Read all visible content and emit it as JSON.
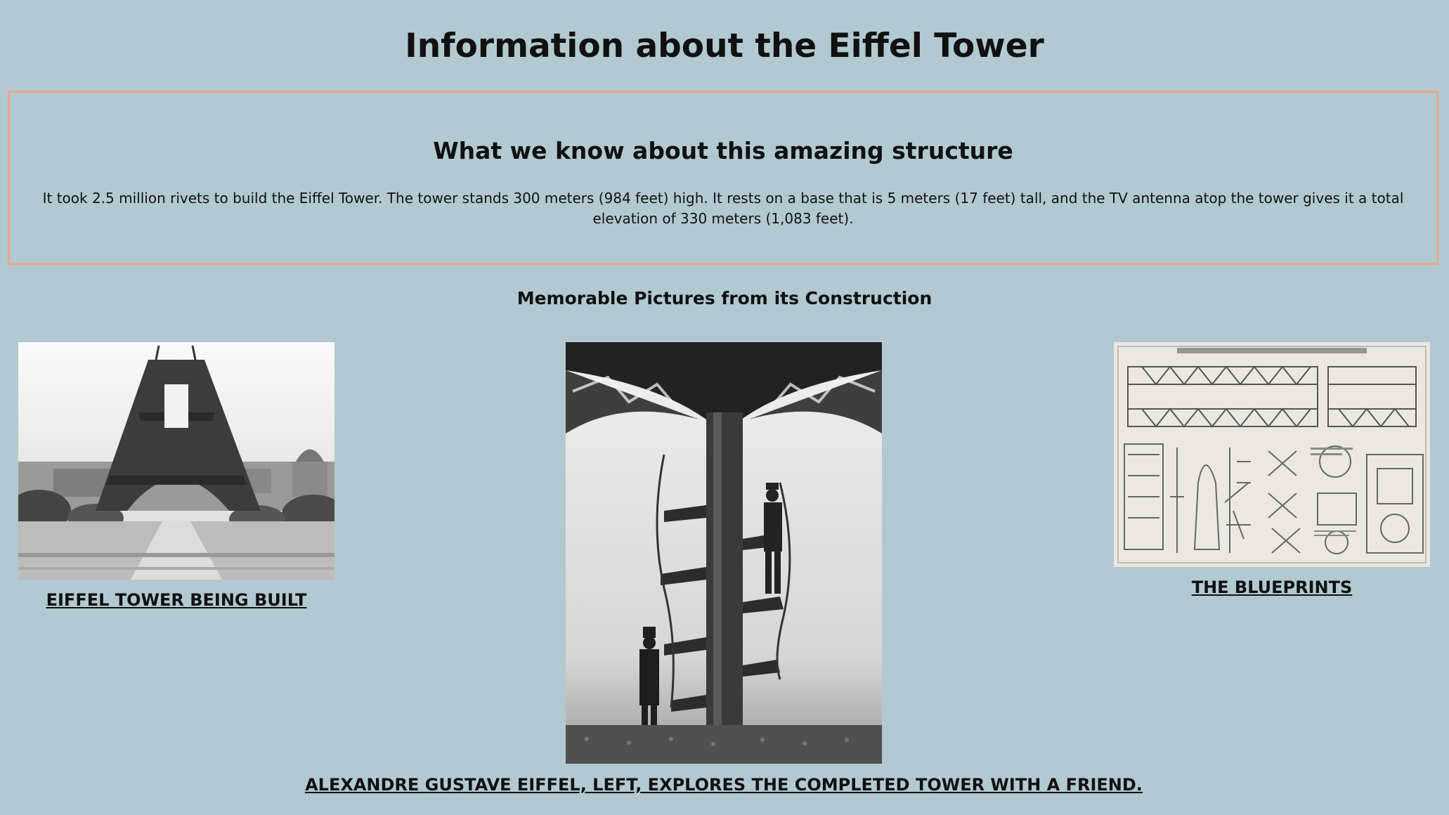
{
  "page": {
    "title": "Information about the Eiffel Tower",
    "background_color": "#b2c9d1",
    "box_border_color": "#eba68a"
  },
  "facts": {
    "heading": "What we know about this amazing structure",
    "text": "It took 2.5 million rivets to build the Eiffel Tower. The tower stands 300 meters (984 feet) high. It rests on a base that is 5 meters (17 feet) tall, and the TV antenna atop the tower gives it a total elevation of 330 meters (1,083 feet)."
  },
  "gallery": {
    "heading": "Memorable Pictures from its Construction",
    "items": [
      {
        "caption": "EIFFEL TOWER BEING BUILT",
        "image": "construction-photo"
      },
      {
        "caption": "ALEXANDRE GUSTAVE EIFFEL, LEFT, EXPLORES THE COMPLETED TOWER WITH A FRIEND.",
        "image": "spiral-staircase-photo"
      },
      {
        "caption": "THE BLUEPRINTS",
        "image": "blueprint-drawing"
      }
    ]
  }
}
